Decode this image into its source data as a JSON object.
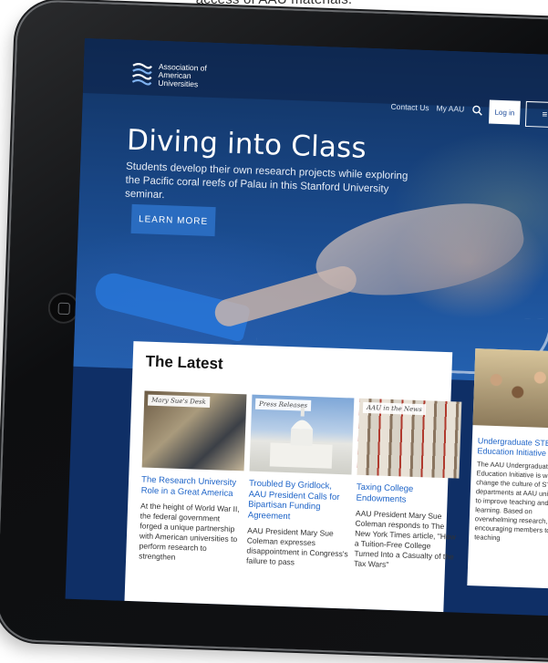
{
  "caption": "access of AAU materials.",
  "header": {
    "logo_text": "Association of American Universities",
    "nav": [
      "Contact Us",
      "My AAU"
    ],
    "login_label": "Log in",
    "menu_label": "≡"
  },
  "hero": {
    "title": "Diving into Class",
    "subtitle": "Students develop their own research projects while exploring the Pacific coral reefs of Palau in this Stanford University seminar.",
    "cta": "LEARN MORE"
  },
  "latest": {
    "heading": "The Latest",
    "cards": [
      {
        "tag": "Mary Sue's Desk",
        "title": "The Research University Role in a Great America",
        "body": "At the height of World War II, the federal government forged a unique partnership with American universities to perform research to strengthen"
      },
      {
        "tag": "Press Releases",
        "title": "Troubled By Gridlock, AAU President Calls for Bipartisan Funding Agreement",
        "body": "AAU President Mary Sue Coleman expresses disappointment in Congress's failure to pass"
      },
      {
        "tag": "AAU in the News",
        "title": "Taxing College Endowments",
        "body": "AAU President Mary Sue Coleman responds to The New York Times article, \"How a Tuition-Free College Turned Into a Casualty of the Tax Wars\""
      }
    ]
  },
  "side": {
    "title": "Undergraduate STEM Education Initiative",
    "body": "The AAU Undergraduate STEM Education Initiative is working to change the culture of STEM departments at AAU universities to improve teaching and learning. Based on overwhelming research, it is encouraging members to use teaching"
  },
  "colors": {
    "link_blue": "#1e64c8",
    "cta_blue": "#2a6cc0"
  }
}
